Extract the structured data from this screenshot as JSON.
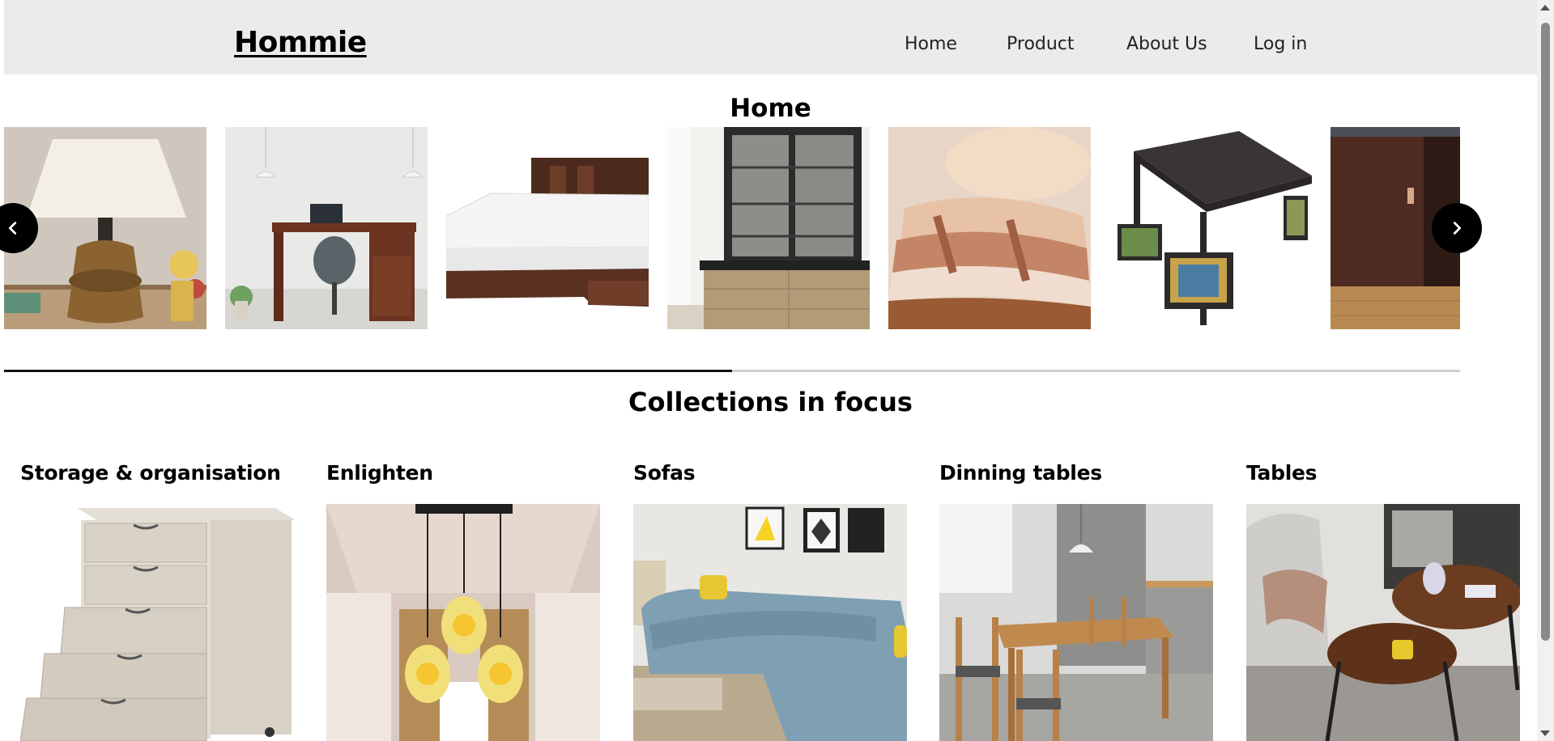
{
  "header": {
    "logo": "Hommie",
    "nav": [
      {
        "label": "Home"
      },
      {
        "label": "Product"
      },
      {
        "label": "About Us"
      },
      {
        "label": "Log in"
      }
    ]
  },
  "hero": {
    "title": "Home",
    "slides": [
      {
        "icon": "table-lamp-image"
      },
      {
        "icon": "study-desk-image"
      },
      {
        "icon": "wooden-bed-image"
      },
      {
        "icon": "display-cabinet-image"
      },
      {
        "icon": "folded-blankets-image"
      },
      {
        "icon": "dining-set-image"
      },
      {
        "icon": "sliding-wardrobe-image"
      }
    ],
    "prev_icon": "chevron-left-icon",
    "next_icon": "chevron-right-icon",
    "progress": 0.5
  },
  "collections": {
    "title": "Collections in focus",
    "items": [
      {
        "label": "Storage & organisation"
      },
      {
        "label": "Enlighten"
      },
      {
        "label": "Sofas"
      },
      {
        "label": "Dinning tables"
      },
      {
        "label": "Tables"
      }
    ]
  },
  "colors": {
    "header_bg": "#ebebeb",
    "accent": "#000000",
    "track": "#cfcfcf"
  }
}
